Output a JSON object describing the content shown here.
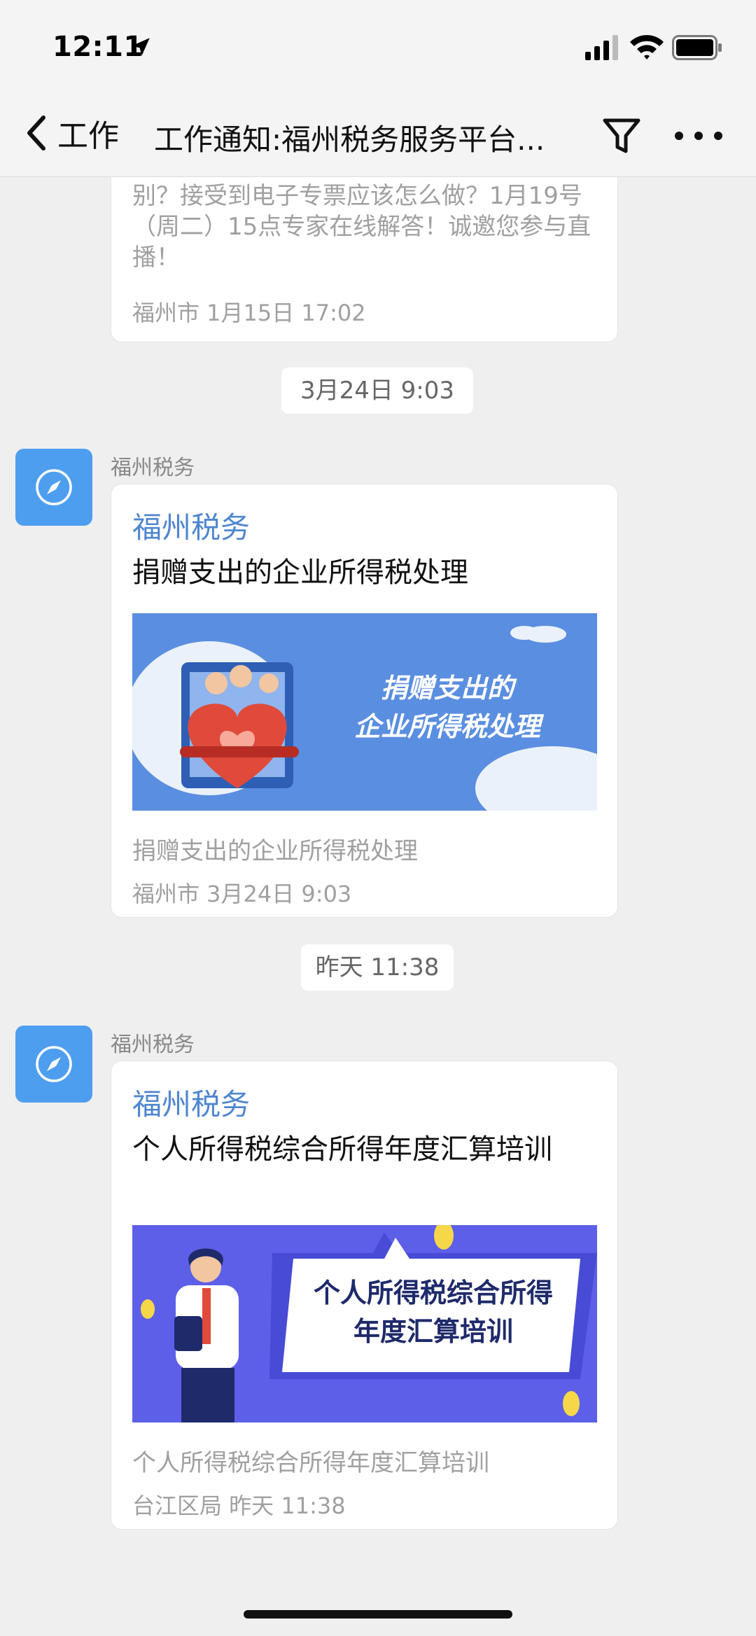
{
  "status_bar": {
    "time": "12:11"
  },
  "nav": {
    "back_label": "工作",
    "title": "工作通知:福州税务服务平台..."
  },
  "previous_message": {
    "desc_fragment": "逐步推进，电子发票与纸质发票有什么区别？接受到电子专票应该怎么做？1月19号（周二）15点专家在线解答！诚邀您参与直播！",
    "meta": "福州市  1月15日 17:02"
  },
  "messages": [
    {
      "timestamp": "3月24日 9:03",
      "sender": "福州税务",
      "source": "福州税务",
      "headline": "捐赠支出的企业所得税处理",
      "banner_text_line1": "捐赠支出的",
      "banner_text_line2": "企业所得税处理",
      "description": "捐赠支出的企业所得税处理",
      "meta": "福州市  3月24日 9:03"
    },
    {
      "timestamp": "昨天 11:38",
      "sender": "福州税务",
      "source": "福州税务",
      "headline": "个人所得税综合所得年度汇算培训",
      "banner_text_line1": "个人所得税综合所得",
      "banner_text_line2": "年度汇算培训",
      "description": "个人所得税综合所得年度汇算培训",
      "meta": "台江区局  昨天 11:38"
    }
  ],
  "colors": {
    "accent": "#4f86d0",
    "avatar": "#4e9ef0",
    "background": "#efefef",
    "banner1": "#5a8ee0",
    "banner2": "#5d5fe8"
  }
}
